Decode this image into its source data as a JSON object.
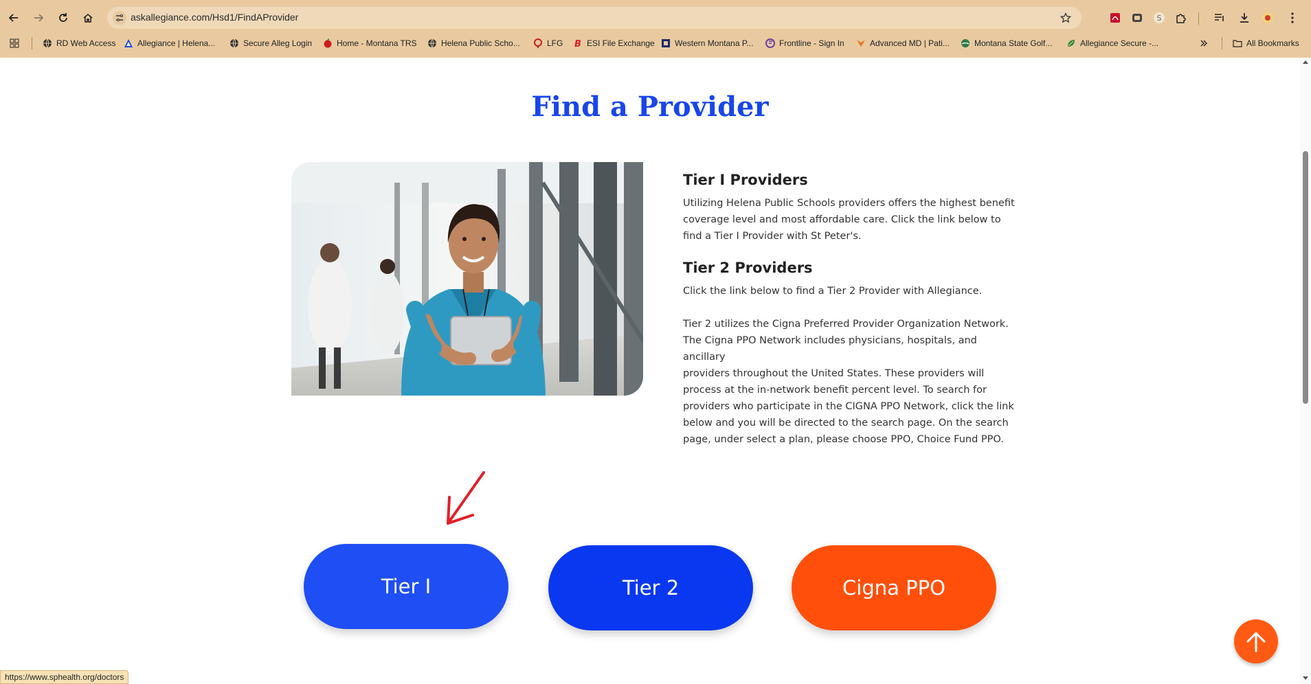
{
  "browser": {
    "url": "askallegiance.com/Hsd1/FindAProvider",
    "bookmarks": [
      {
        "label": "RD Web Access",
        "icon": "globe-icon"
      },
      {
        "label": "Allegiance | Helena...",
        "icon": "allegiance-icon"
      },
      {
        "label": "Secure Alleg Login",
        "icon": "globe-icon"
      },
      {
        "label": "Home - Montana TRS",
        "icon": "apple-icon"
      },
      {
        "label": "Helena Public Scho...",
        "icon": "globe-icon"
      },
      {
        "label": "LFG",
        "icon": "lfg-icon"
      },
      {
        "label": "ESI File Exchange",
        "icon": "esi-icon"
      },
      {
        "label": "Western Montana P...",
        "icon": "square-icon"
      },
      {
        "label": "Frontline - Sign In",
        "icon": "frontline-icon"
      },
      {
        "label": "Advanced MD | Pati...",
        "icon": "amd-icon"
      },
      {
        "label": "Montana State Golf...",
        "icon": "golf-icon"
      },
      {
        "label": "Allegiance Secure -...",
        "icon": "leaf-icon"
      }
    ],
    "all_bookmarks_label": "All Bookmarks",
    "status_url": "https://www.sphealth.org/doctors"
  },
  "page": {
    "title": "Find a Provider",
    "tier1": {
      "heading": "Tier I Providers",
      "body_lines": [
        "Utilizing Helena Public Schools providers offers the highest benefit",
        "coverage level and most affordable care. Click the link below to",
        "find a Tier I Provider with St Peter's."
      ]
    },
    "tier2": {
      "heading": "Tier 2 Providers",
      "intro": "Click the link below to find a Tier 2 Provider with Allegiance.",
      "body_lines": [
        "Tier 2 utilizes the Cigna Preferred Provider Organization Network.",
        "The Cigna PPO Network includes physicians, hospitals, and ancillary",
        "providers throughout the United States. These providers will",
        "process at the in-network benefit percent level. To search for",
        "providers who participate in the CIGNA PPO Network, click the link",
        "below and you will be directed to the search page. On the search",
        "page, under select a plan, please choose PPO, Choice Fund PPO."
      ]
    },
    "buttons": {
      "tier1": "Tier I",
      "tier2": "Tier 2",
      "cigna": "Cigna PPO"
    },
    "colors": {
      "title_blue": "#1846e8",
      "tier1_blue": "#1f4ef5",
      "tier2_blue": "#0a38f0",
      "cigna_orange": "#ff4f0a",
      "arrow_red": "#e0202a",
      "chrome_tan": "#e9caa0"
    }
  }
}
